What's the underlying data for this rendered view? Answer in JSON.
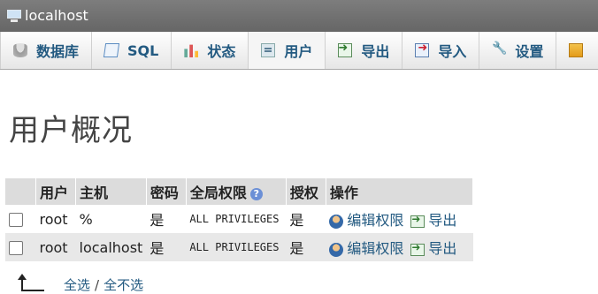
{
  "titlebar": {
    "server": "localhost"
  },
  "tabs": [
    {
      "label": "数据库",
      "icon": "database-icon"
    },
    {
      "label": "SQL",
      "icon": "sql-icon"
    },
    {
      "label": "状态",
      "icon": "status-icon"
    },
    {
      "label": "用户",
      "icon": "users-icon",
      "active": true
    },
    {
      "label": "导出",
      "icon": "export-icon"
    },
    {
      "label": "导入",
      "icon": "import-icon"
    },
    {
      "label": "设置",
      "icon": "wrench-icon"
    }
  ],
  "page": {
    "heading": "用户概况"
  },
  "table": {
    "headers": {
      "user": "用户",
      "host": "主机",
      "password": "密码",
      "global_privileges": "全局权限",
      "grant": "授权",
      "action": "操作"
    },
    "rows": [
      {
        "user": "root",
        "host": "%",
        "password": "是",
        "privileges": "ALL PRIVILEGES",
        "grant": "是",
        "edit": "编辑权限",
        "export": "导出"
      },
      {
        "user": "root",
        "host": "localhost",
        "password": "是",
        "privileges": "ALL PRIVILEGES",
        "grant": "是",
        "edit": "编辑权限",
        "export": "导出"
      }
    ]
  },
  "footer": {
    "select_all": "全选",
    "separator": "/",
    "deselect_all": "全不选"
  },
  "colors": {
    "titlebar": "#6f6f6f",
    "link": "#235a81",
    "header_bg": "#dcdcdc",
    "row_alt": "#e8e8e8"
  }
}
